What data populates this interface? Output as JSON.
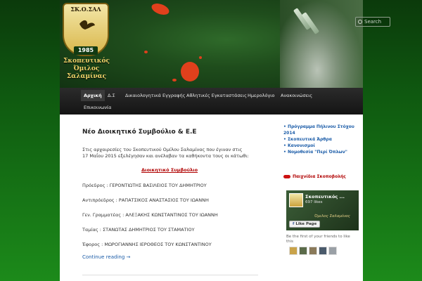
{
  "logo": {
    "top_text": "ΣΚ.Ο.ΣΑΛ",
    "year": "1985",
    "name_line1": "Σκοπευτικός",
    "name_line2": "Όμιλος",
    "name_line3": "Σαλαμίνας"
  },
  "search": {
    "placeholder": "Search"
  },
  "nav": {
    "items": [
      {
        "label": "Αρχική",
        "active": true
      },
      {
        "label": "Δ.Σ"
      },
      {
        "label": "Δικαιολογητικά Εγγραφής"
      },
      {
        "label": "Αθλητικές Εγκαταστάσεις"
      },
      {
        "label": "Ημερολόγιο"
      },
      {
        "label": "Ανακοινώσεις"
      },
      {
        "label": "Επικοινωνία"
      }
    ]
  },
  "post": {
    "title": "Νέο Διοικητικό Συμβούλιο & Ε.Ε",
    "intro_line1": "Στις αρχαιρεσίες του Σκοπευτικού Ομίλου Σαλαμίνας που έγιναν στις",
    "intro_line2": "17 Μαΐου 2015 εξελέγησαν και ανέλαβαν τα καθήκοντα τους οι κάτωθι:",
    "board_heading": "Διοικητικό Συμβούλιο",
    "members": [
      "Πρόεδρος : ΓΕΡΟΝΤΙΩΤΗΣ ΒΑΣΙΛΕΙΟΣ ΤΟΥ ΔΗΜΗΤΡΙΟΥ",
      "Αντιπρόεδρος : ΡΑΠΑΤΣΙΚΟΣ ΑΝΑΣΤΑΣΙΟΣ ΤΟΥ ΙΩΑΝΝΗ",
      "Γεν. Γραμματέας : ΑΛΕΞΑΚΗΣ ΚΩΝΣΤΑΝΤΙΝΟΣ ΤΟΥ ΙΩΑΝΝΗ",
      "Ταμίας : ΣΤΑΝΩΤΑΣ ΔΗΜΗΤΡΙΟΣ ΤΟΥ ΣΤΑΜΑΤΙΟΥ",
      "Έφορος : ΜΩΡΟΓΙΑΝΝΗΣ ΙΕΡΟΘΕΟΣ ΤΟΥ ΚΩΝΣΤΑΝΤΙΝΟΥ"
    ],
    "continue": "Continue reading →"
  },
  "sidebar": {
    "links": [
      "Πρόγραμμα Πήλινου Στόχου 2014",
      "Σκοπευτικά Άρθρα",
      "Κανονισμοί",
      "Νομοθεσία \"Περί Όπλων\""
    ],
    "toy_guns": "Παιχνίδια Σκοποβολής",
    "facebook": {
      "name": "Σκοπευτικός ...",
      "likes": "697 likes",
      "subtitle": "Όμιλος Σαλαμίνας",
      "like_button": "Like Page",
      "friends_text": "Be the first of your friends to like this"
    }
  },
  "colors": {
    "nav_bg": "#141414",
    "link": "#1b5ca8",
    "accent_red": "#b00000"
  }
}
